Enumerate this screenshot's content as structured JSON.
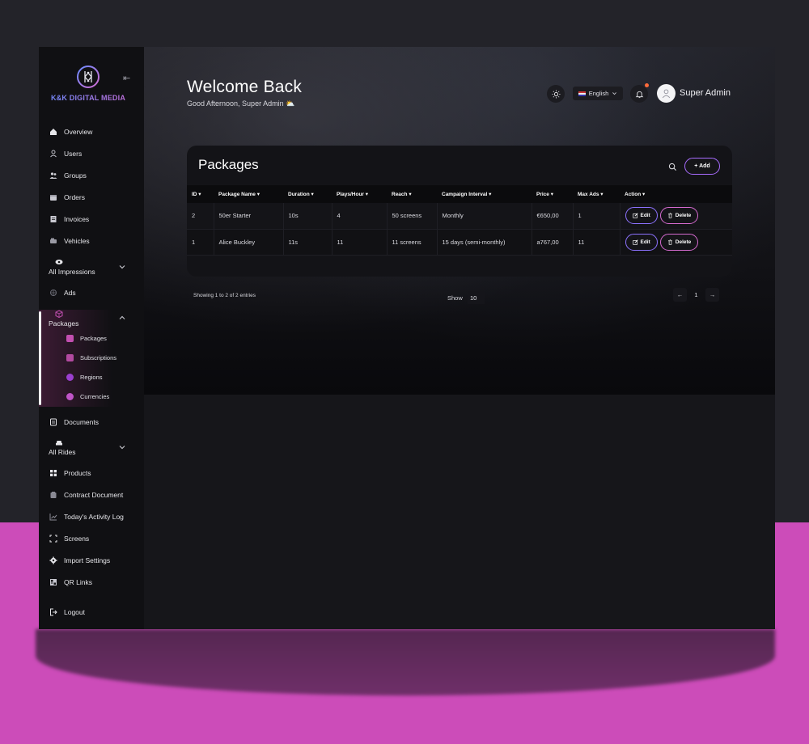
{
  "brand": {
    "name": "K&K DIGITAL MEDIA"
  },
  "sidebar": {
    "items": [
      {
        "label": "Overview",
        "icon": "home-icon"
      },
      {
        "label": "Users",
        "icon": "user-icon"
      },
      {
        "label": "Groups",
        "icon": "users-icon"
      },
      {
        "label": "Orders",
        "icon": "box-icon"
      },
      {
        "label": "Invoices",
        "icon": "invoice-icon"
      },
      {
        "label": "Vehicles",
        "icon": "vehicle-icon"
      }
    ],
    "impressions": {
      "label": "All Impressions",
      "icon": "eye-icon"
    },
    "ads": {
      "label": "Ads",
      "icon": "ads-icon"
    },
    "packages": {
      "label": "Packages",
      "icon": "cube-icon",
      "sub": [
        {
          "label": "Packages",
          "color": "#c24fb0"
        },
        {
          "label": "Subscriptions",
          "color": "#b24aa0"
        },
        {
          "label": "Regions",
          "color": "#9b3fd0"
        },
        {
          "label": "Currencies",
          "color": "#c055c8"
        }
      ]
    },
    "documents": {
      "label": "Documents",
      "icon": "document-icon"
    },
    "rides": {
      "label": "All Rides",
      "icon": "car-icon"
    },
    "bottom_items": [
      {
        "label": "Products",
        "icon": "grid-icon"
      },
      {
        "label": "Contract Document",
        "icon": "contract-icon"
      },
      {
        "label": "Today's Activity Log",
        "icon": "chart-icon"
      },
      {
        "label": "Screens",
        "icon": "screen-icon"
      },
      {
        "label": "Import Settings",
        "icon": "gear-icon"
      },
      {
        "label": "QR Links",
        "icon": "qr-icon"
      }
    ],
    "logout": {
      "label": "Logout",
      "icon": "logout-icon"
    }
  },
  "header": {
    "title": "Welcome Back",
    "greeting": "Good Afternoon, Super Admin ⛅",
    "language": "English",
    "user_name": "Super Admin"
  },
  "packages_card": {
    "title": "Packages",
    "add_label": "+ Add",
    "columns": [
      "ID",
      "Package Name",
      "Duration",
      "Plays/Hour",
      "Reach",
      "Campaign Interval",
      "Price",
      "Max Ads",
      "Action"
    ],
    "rows": [
      {
        "id": "2",
        "name": "50er Starter",
        "duration": "10s",
        "plays": "4",
        "reach": "50 screens",
        "interval": "Monthly",
        "price": "€650,00",
        "max_ads": "1"
      },
      {
        "id": "1",
        "name": "Alice Buckley",
        "duration": "11s",
        "plays": "11",
        "reach": "11 screens",
        "interval": "15 days (semi-monthly)",
        "price": "a767,00",
        "max_ads": "11"
      }
    ],
    "edit_label": "Edit",
    "delete_label": "Delete"
  },
  "pagination": {
    "showing": "Showing 1 to 2 of 2 entries",
    "show_label": "Show",
    "show_value": "10",
    "prev": "←",
    "page": "1",
    "next": "→"
  },
  "colors": {
    "accent_pink": "#cc4cb9",
    "accent_purple": "#8d72ff",
    "notification": "#ff6b3a"
  }
}
